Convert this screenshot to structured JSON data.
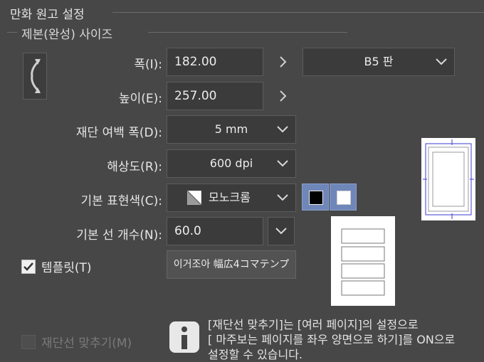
{
  "section": {
    "title": "만화 원고 설정",
    "subsection": "제본(완성) 사이즈"
  },
  "width": {
    "label": "폭(I):",
    "value": "182.00"
  },
  "height": {
    "label": "높이(E):",
    "value": "257.00"
  },
  "paper_preset": {
    "value": "B5 판"
  },
  "bleed": {
    "label": "재단 여백 폭(D):",
    "value": "5 mm"
  },
  "resolution": {
    "label": "해상도(R):",
    "value": "600 dpi"
  },
  "color_mode": {
    "label": "기본 표현색(C):",
    "value": "모노크롬"
  },
  "line_count": {
    "label": "기본 선 개수(N):",
    "value": "60.0"
  },
  "template": {
    "label": "템플릿(T)",
    "checked": true,
    "button_label": "이거조아 幅広4コマテンプ"
  },
  "trim_align": {
    "label": "재단선 맞추기(M)",
    "info_lines": [
      "[재단선 맞추기]는 [여러 페이지]의 설정으로",
      "[ 마주보는 페이지를 좌우 양면으로 하기]를 ON으로",
      "설정할 수 있습니다."
    ]
  },
  "colors": {
    "background": "#474747",
    "field": "#3b3b3b",
    "accent": "#6f86b8",
    "preview_guide": "#3b3bd6"
  }
}
